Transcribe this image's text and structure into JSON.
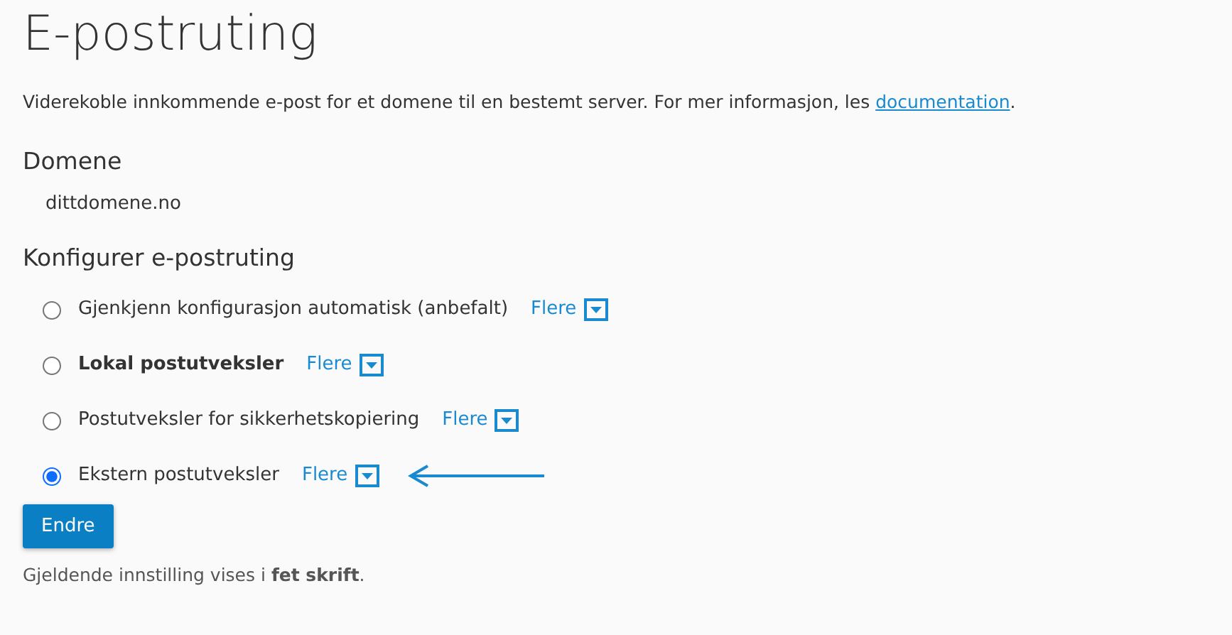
{
  "title": "E-postruting",
  "intro": {
    "text": "Viderekoble innkommende e-post for et domene til en bestemt server. For mer informasjon, les ",
    "link": "documentation",
    "after": "."
  },
  "domain": {
    "heading": "Domene",
    "value": "dittdomene.no"
  },
  "config": {
    "heading": "Konfigurer e-postruting",
    "options": [
      {
        "label": "Gjenkjenn konfigurasjon automatisk (anbefalt)",
        "selected": false,
        "current": false,
        "more": "Flere",
        "arrow": false
      },
      {
        "label": "Lokal postutveksler",
        "selected": false,
        "current": true,
        "more": "Flere",
        "arrow": false
      },
      {
        "label": "Postutveksler for sikkerhetskopiering",
        "selected": false,
        "current": false,
        "more": "Flere",
        "arrow": false
      },
      {
        "label": "Ekstern postutveksler",
        "selected": true,
        "current": false,
        "more": "Flere",
        "arrow": true
      }
    ]
  },
  "button": "Endre",
  "footnote": "Gjeldende innstilling vises i **fet skrift**."
}
